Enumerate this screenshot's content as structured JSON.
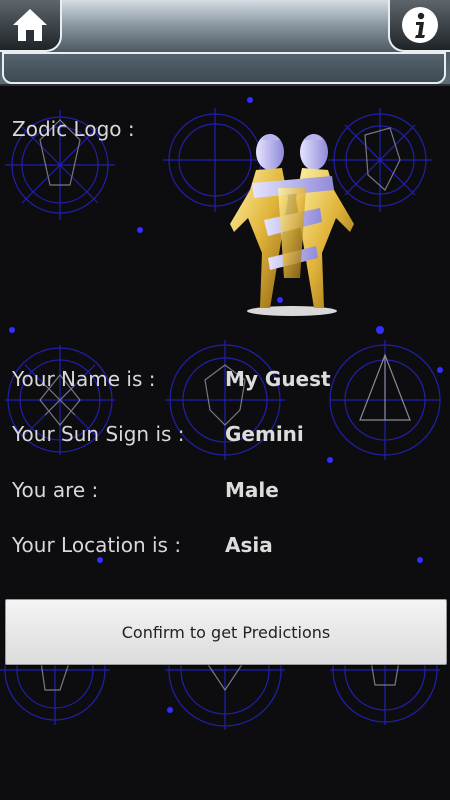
{
  "colors": {
    "background": "#0d0d10",
    "decoration": "#2a2ad8",
    "text": "#d8d8d8",
    "button_bg": "#e8e8e8"
  },
  "header": {
    "home_icon": "home-icon",
    "info_icon": "info-icon"
  },
  "zodiac": {
    "logo_label": "Zodic Logo :",
    "logo_icon": "gemini-twins-figure"
  },
  "fields": [
    {
      "label": "Your Name is :",
      "value": "My Guest"
    },
    {
      "label": "Your Sun Sign is :",
      "value": "Gemini"
    },
    {
      "label": "You are :",
      "value": "Male"
    },
    {
      "label": "Your Location is :",
      "value": "Asia"
    }
  ],
  "confirm_button": {
    "label": "Confirm to get Predictions"
  }
}
